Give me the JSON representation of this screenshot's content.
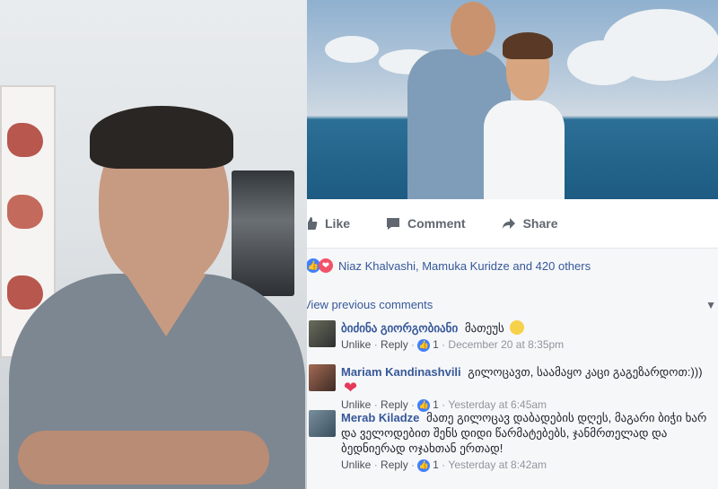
{
  "actions": {
    "like": "Like",
    "comment": "Comment",
    "share": "Share"
  },
  "reactions": {
    "text": "Niaz Khalvashi, Mamuka Kuridze and 420 others"
  },
  "comments_section": {
    "view_previous": "View previous comments",
    "items": [
      {
        "name": "ბიძინა გიორგობიანი",
        "text": "მათეუს",
        "emoji": "smile",
        "unlike": "Unlike",
        "reply": "Reply",
        "likes": "1",
        "time": "December 20 at 8:35pm"
      },
      {
        "name": "Mariam Kandinashvili",
        "text": "გილოცავთ, საამაყო კაცი გაგეზარდოთ:)))",
        "emoji": "heart",
        "unlike": "Unlike",
        "reply": "Reply",
        "likes": "1",
        "time": "Yesterday at 6:45am"
      },
      {
        "name": "Merab Kiladze",
        "text": "მათე გილოცავ დაბადების დღეს, მაგარი ბიჭი ხარ და ველოდებით შენს დიდი წარმატებებს, ჯანმრთელად და ბედნიერად ოჯახთან ერთად!",
        "unlike": "Unlike",
        "reply": "Reply",
        "likes": "1",
        "time": "Yesterday at 8:42am"
      }
    ]
  },
  "colors": {
    "link_blue": "#365899",
    "like_blue": "#4080ff",
    "love_red": "#f25268",
    "meta_gray": "#90949c"
  }
}
